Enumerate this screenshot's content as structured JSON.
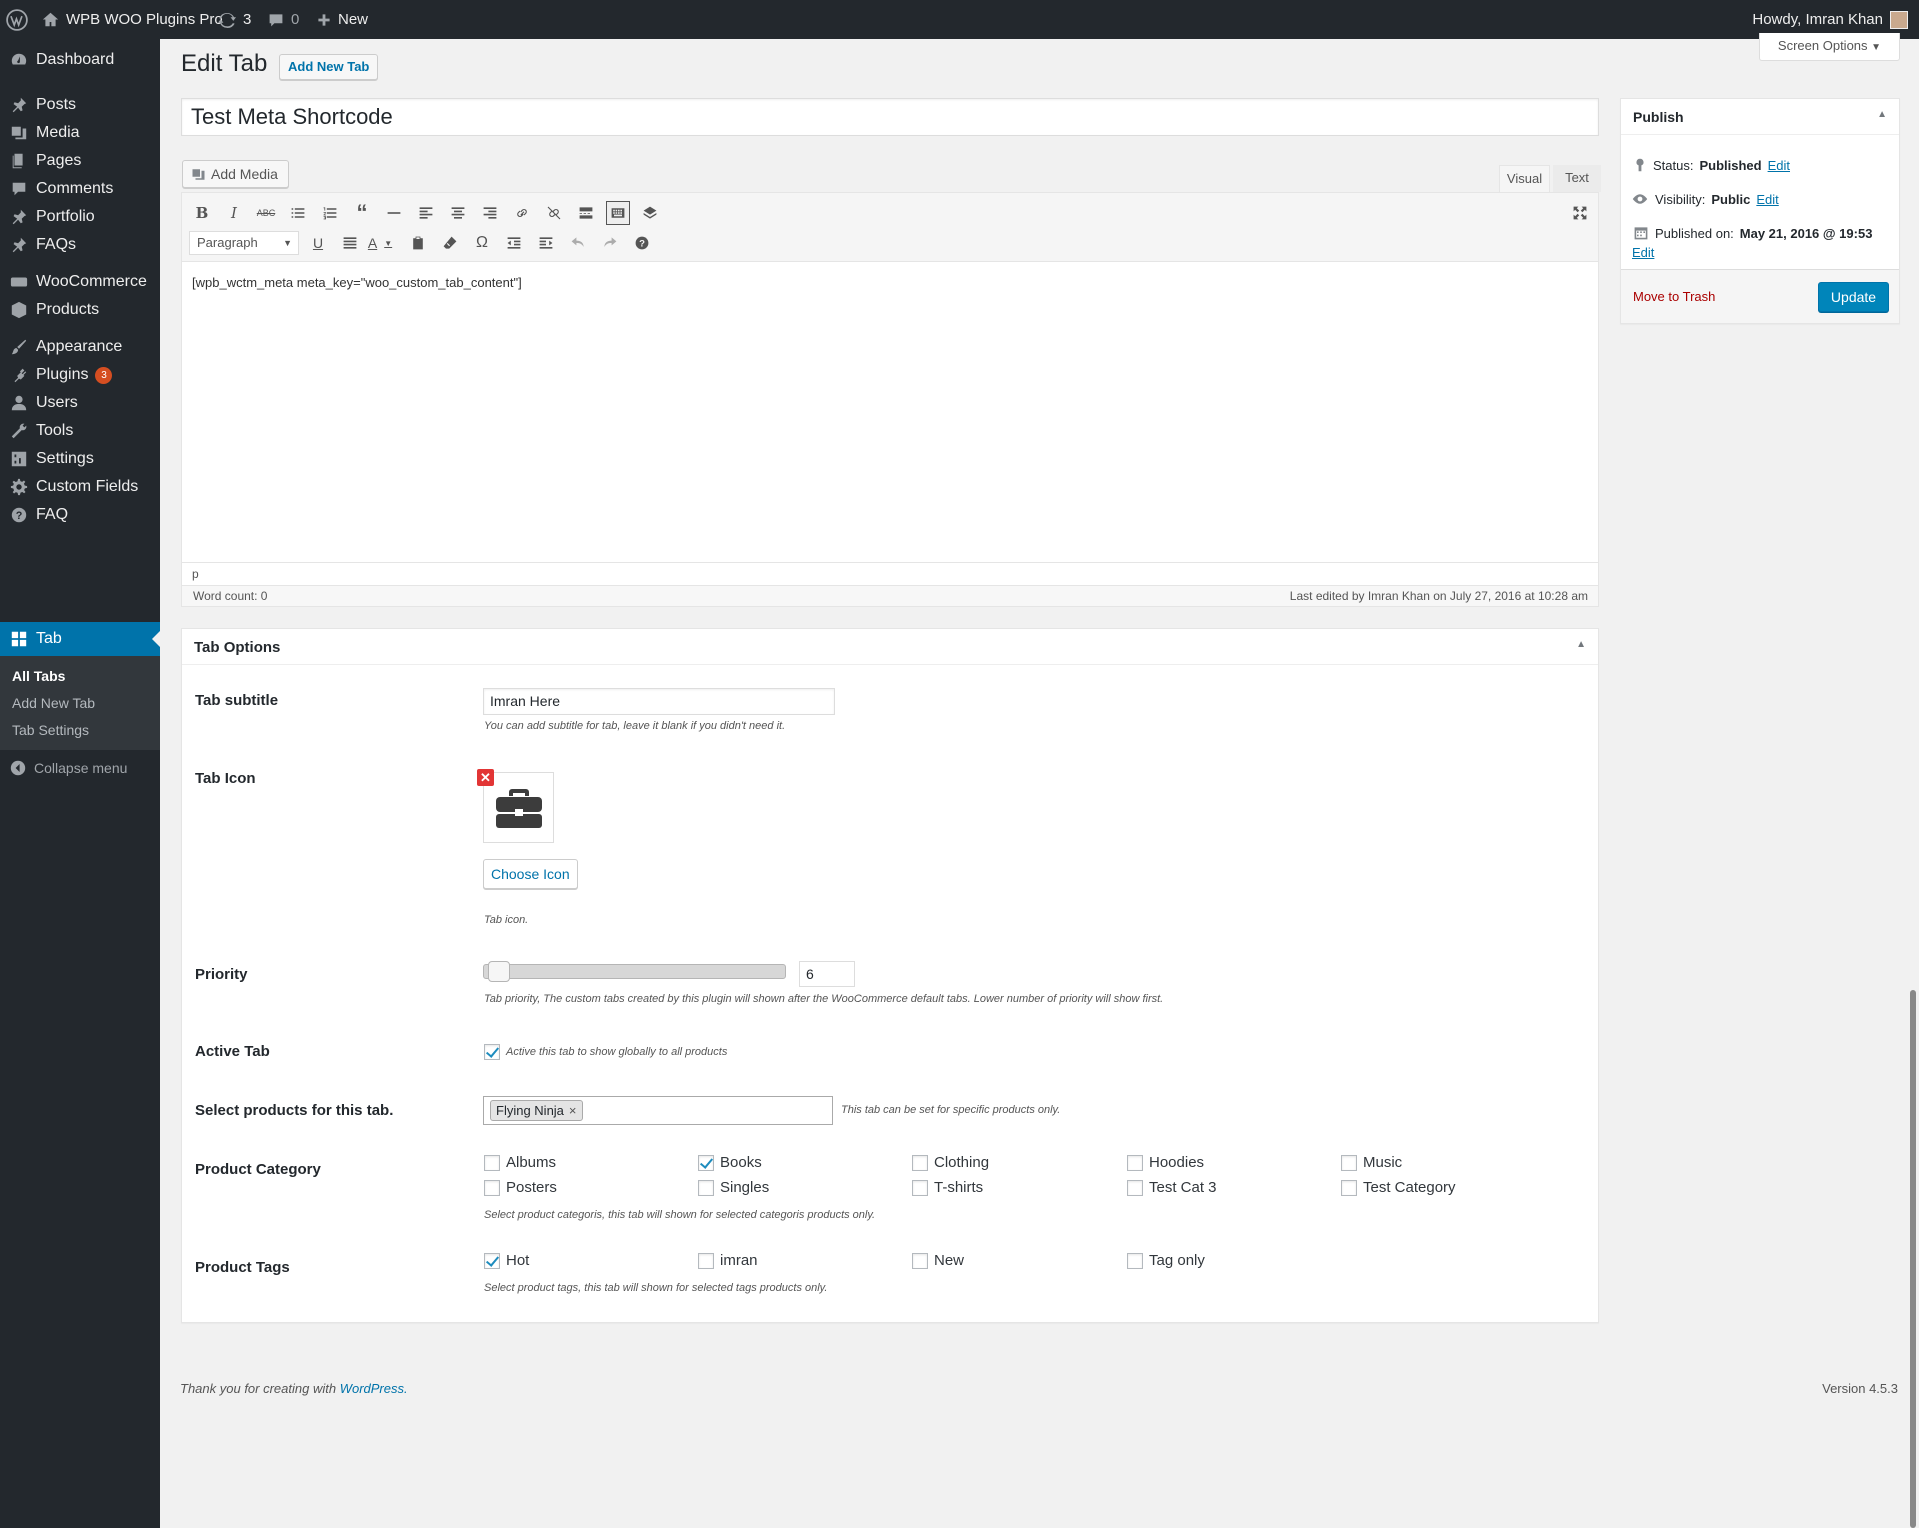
{
  "adminbar": {
    "site_name": "WPB WOO Plugins Pro",
    "updates_count": "3",
    "comments_count": "0",
    "new_label": "New",
    "howdy": "Howdy, Imran Khan"
  },
  "sidebar": {
    "items": [
      {
        "label": "Dashboard",
        "icon": "dashboard-icon"
      },
      {
        "label": "Posts",
        "icon": "pin-icon"
      },
      {
        "label": "Media",
        "icon": "media-icon"
      },
      {
        "label": "Pages",
        "icon": "pages-icon"
      },
      {
        "label": "Comments",
        "icon": "comment-icon"
      },
      {
        "label": "Portfolio",
        "icon": "pin-icon"
      },
      {
        "label": "FAQs",
        "icon": "pin-icon"
      },
      {
        "label": "WooCommerce",
        "icon": "woo-icon"
      },
      {
        "label": "Products",
        "icon": "products-icon"
      },
      {
        "label": "Appearance",
        "icon": "brush-icon"
      },
      {
        "label": "Plugins",
        "icon": "plugin-icon",
        "badge": "3"
      },
      {
        "label": "Users",
        "icon": "user-icon"
      },
      {
        "label": "Tools",
        "icon": "wrench-icon"
      },
      {
        "label": "Settings",
        "icon": "settings-icon"
      },
      {
        "label": "Custom Fields",
        "icon": "gear-icon"
      },
      {
        "label": "FAQ",
        "icon": "help-icon"
      },
      {
        "label": "Tab",
        "icon": "grid-icon"
      }
    ],
    "submenu": [
      "All Tabs",
      "Add New Tab",
      "Tab Settings"
    ],
    "collapse": "Collapse menu"
  },
  "screen_options": "Screen Options",
  "page": {
    "title": "Edit Tab",
    "add_new": "Add New Tab",
    "post_title": "Test Meta Shortcode"
  },
  "editor": {
    "add_media": "Add Media",
    "tab_visual": "Visual",
    "tab_text": "Text",
    "format_select": "Paragraph",
    "content": "[wpb_wctm_meta meta_key=\"woo_custom_tab_content\"]",
    "path": "p",
    "word_count": "Word count: 0",
    "last_edited": "Last edited by Imran Khan on July 27, 2016 at 10:28 am"
  },
  "publish": {
    "title": "Publish",
    "status_label": "Status:",
    "status_value": "Published",
    "visibility_label": "Visibility:",
    "visibility_value": "Public",
    "published_label": "Published on:",
    "published_value": "May 21, 2016 @ 19:53",
    "edit": "Edit",
    "trash": "Move to Trash",
    "update": "Update"
  },
  "tab_options": {
    "title": "Tab Options",
    "subtitle_label": "Tab subtitle",
    "subtitle_value": "Imran Here",
    "subtitle_desc": "You can add subtitle for tab, leave it blank if you didn't need it.",
    "icon_label": "Tab Icon",
    "icon_name": "briefcase-icon",
    "choose_icon": "Choose Icon",
    "icon_desc": "Tab icon.",
    "priority_label": "Priority",
    "priority_value": "6",
    "priority_desc": "Tab priority, The custom tabs created by this plugin will shown after the WooCommerce default tabs. Lower number of priority will show first.",
    "active_label": "Active Tab",
    "active_desc": "Active this tab to show globally to all products",
    "active_checked": true,
    "products_label": "Select products for this tab.",
    "products_selected": "Flying Ninja",
    "products_desc": "This tab can be set for specific products only.",
    "category_label": "Product Category",
    "categories": [
      {
        "name": "Albums",
        "checked": false
      },
      {
        "name": "Books",
        "checked": true
      },
      {
        "name": "Clothing",
        "checked": false
      },
      {
        "name": "Hoodies",
        "checked": false
      },
      {
        "name": "Music",
        "checked": false
      },
      {
        "name": "Posters",
        "checked": false
      },
      {
        "name": "Singles",
        "checked": false
      },
      {
        "name": "T-shirts",
        "checked": false
      },
      {
        "name": "Test Cat 3",
        "checked": false
      },
      {
        "name": "Test Category",
        "checked": false
      }
    ],
    "category_desc": "Select product categoris, this tab will shown for selected categoris products only.",
    "tags_label": "Product Tags",
    "tags": [
      {
        "name": "Hot",
        "checked": true
      },
      {
        "name": "imran",
        "checked": false
      },
      {
        "name": "New",
        "checked": false
      },
      {
        "name": "Tag only",
        "checked": false
      }
    ],
    "tags_desc": "Select product tags, this tab will shown for selected tags products only."
  },
  "footer": {
    "thanks": "Thank you for creating with",
    "wordpress": "WordPress.",
    "version": "Version 4.5.3"
  }
}
